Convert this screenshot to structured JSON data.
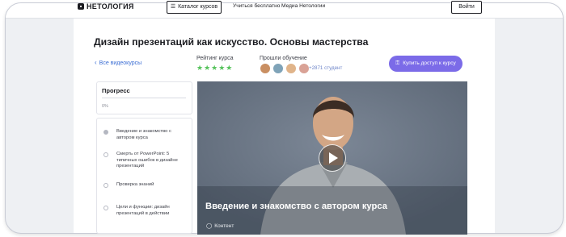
{
  "header": {
    "logo_text": "НЕТОЛОГИЯ",
    "catalog_label": "Каталог курсов",
    "catalog_icon": "catalog-list-icon",
    "nav_links": [
      "Учиться бесплатно",
      "Медиа Нетологии"
    ],
    "login_label": "Войти"
  },
  "course": {
    "title": "Дизайн презентаций как искусство. Основы мастерства",
    "back_label": "Все видеокурсы",
    "rating_label": "Рейтинг курса",
    "stars": "★★★★★",
    "rating_value": 5,
    "learned_label": "Прошли обучение",
    "learners_count": "+2871 студент",
    "buy_label": "Купить доступ к курсу",
    "buy_icon": "key-icon"
  },
  "progress": {
    "title": "Прогресс",
    "value": "0%",
    "fraction": 0.0
  },
  "lessons": [
    {
      "title": "Введение и знакомство с автором курса",
      "active": true
    },
    {
      "title": "Смерть от PowerPoint: 5 типичных ошибок в дизайне презентаций",
      "active": false
    },
    {
      "title": "Проверка знаний",
      "active": false
    },
    {
      "title": "Цели и функции: дизайн презентаций в действии",
      "active": false
    }
  ],
  "video": {
    "title": "Введение и знакомство с автором курса",
    "tag_label": "Контент",
    "tag_icon": "tag-icon"
  },
  "colors": {
    "accent": "#7b6be8",
    "stars": "#56c35c",
    "link": "#3b6ed4",
    "video_bg": "#6d7887"
  }
}
